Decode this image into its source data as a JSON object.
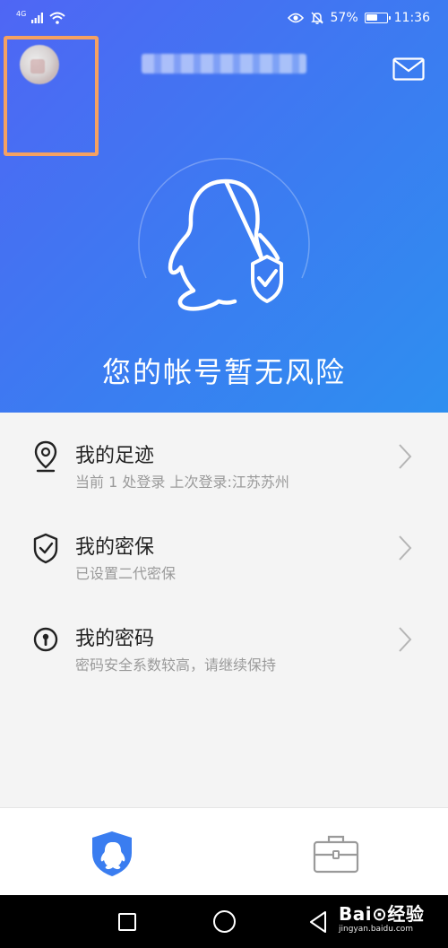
{
  "status_bar": {
    "network": "4G",
    "battery_percent_label": "57%",
    "battery_level": 0.57,
    "time": "11:36"
  },
  "header": {
    "account_name": "",
    "avatar_highlighted": true
  },
  "hero": {
    "status_text": "您的帐号暂无风险"
  },
  "menu": {
    "items": [
      {
        "title": "我的足迹",
        "subtitle": "当前 1 处登录 上次登录:江苏苏州",
        "icon": "location-pin-icon"
      },
      {
        "title": "我的密保",
        "subtitle": "已设置二代密保",
        "icon": "shield-check-icon"
      },
      {
        "title": "我的密码",
        "subtitle": "密码安全系数较高，请继续保持",
        "icon": "keyhole-icon"
      }
    ]
  },
  "tabbar": {
    "tabs": [
      {
        "icon": "security-shield-icon",
        "active": true
      },
      {
        "icon": "toolbox-icon",
        "active": false
      }
    ]
  },
  "watermark": {
    "brand": "Bai⊙经验",
    "url": "jingyan.baidu.com"
  },
  "colors": {
    "hero_gradient_start": "#4f66f4",
    "hero_gradient_end": "#2e8ff0",
    "highlight_box": "#f5a162",
    "active_tab": "#3a7df0",
    "inactive_icon": "#9a9a9a"
  }
}
